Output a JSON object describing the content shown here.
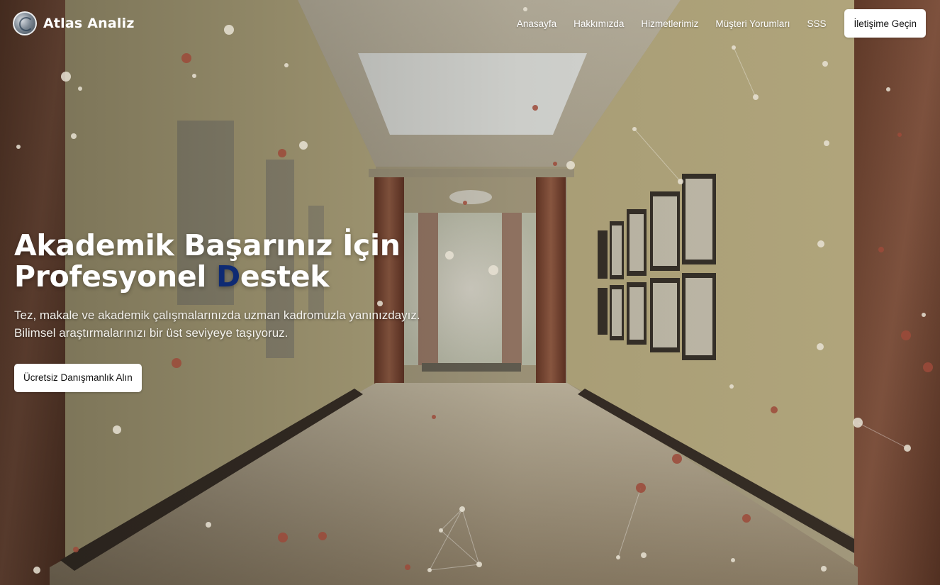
{
  "brand": {
    "name": "Atlas Analiz",
    "logo_icon": "globe-logo-icon"
  },
  "nav": {
    "links": [
      "Anasayfa",
      "Hakkımızda",
      "Hizmetlerimiz",
      "Müşteri Yorumları",
      "SSS"
    ],
    "cta_label": "İletişime Geçin"
  },
  "hero": {
    "title_line1": "Akademik Başarınız İçin",
    "title_line2_prefix": "Profesyonel ",
    "title_line2_accent": "D",
    "title_line2_suffix": "estek",
    "description_line1": "Tez, makale ve akademik çalışmalarınızda uzman kadromuzla yanınızdayız.",
    "description_line2": "Bilimsel araştırmalarınızı bir üst seviyeye taşıyoruz.",
    "button_label": "Ücretsiz Danışmanlık Alın"
  },
  "colors": {
    "accent": "#0e2a73",
    "button_bg": "#ffffff",
    "particle_light": "#e8e2d4",
    "particle_brown": "#9c4a3a"
  }
}
